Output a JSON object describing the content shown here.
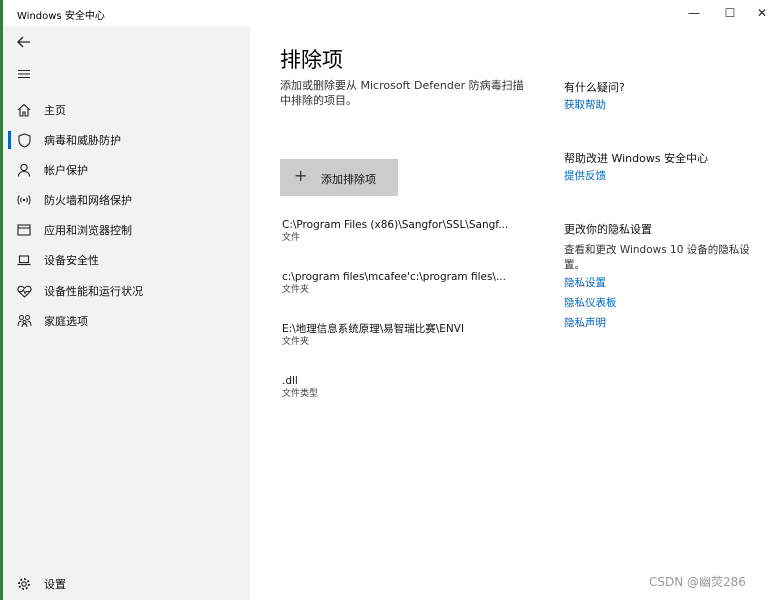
{
  "window": {
    "title": "Windows 安全中心",
    "controls": {
      "minimize": "—",
      "maximize": "☐",
      "close": "✕"
    }
  },
  "sidebar": {
    "items": [
      {
        "label": "主页",
        "icon": "home-icon"
      },
      {
        "label": "病毒和威胁防护",
        "icon": "shield-icon",
        "active": true
      },
      {
        "label": "帐户保护",
        "icon": "person-icon"
      },
      {
        "label": "防火墙和网络保护",
        "icon": "wifi-icon"
      },
      {
        "label": "应用和浏览器控制",
        "icon": "app-window-icon"
      },
      {
        "label": "设备安全性",
        "icon": "laptop-icon"
      },
      {
        "label": "设备性能和运行状况",
        "icon": "heart-pulse-icon"
      },
      {
        "label": "家庭选项",
        "icon": "family-icon"
      }
    ],
    "settings_label": "设置"
  },
  "main": {
    "title": "排除项",
    "description": "添加或删除要从 Microsoft Defender 防病毒扫描中排除的项目。",
    "add_button": {
      "icon": "+",
      "label": "添加排除项"
    },
    "exclusions": [
      {
        "path": "C:\\Program Files (x86)\\Sangfor\\SSL\\Sangf...",
        "type": "文件"
      },
      {
        "path": "c:\\program files\\mcafee'c:\\program files\\...",
        "type": "文件夹"
      },
      {
        "path": "E:\\地理信息系统原理\\易智瑞比赛\\ENVI",
        "type": "文件夹"
      },
      {
        "path": ".dll",
        "type": "文件类型"
      }
    ]
  },
  "right": {
    "help": {
      "heading": "有什么疑问?",
      "link": "获取帮助"
    },
    "feedback": {
      "heading": "帮助改进 Windows 安全中心",
      "link": "提供反馈"
    },
    "privacy": {
      "heading": "更改你的隐私设置",
      "text": "查看和更改 Windows 10 设备的隐私设置。",
      "links": [
        "隐私设置",
        "隐私仪表板",
        "隐私声明"
      ]
    }
  },
  "watermark": "CSDN @幽荧286",
  "colors": {
    "accent": "#0067c0",
    "sidebar_bg": "#f2f2f2",
    "button_bg": "#cccccc"
  }
}
